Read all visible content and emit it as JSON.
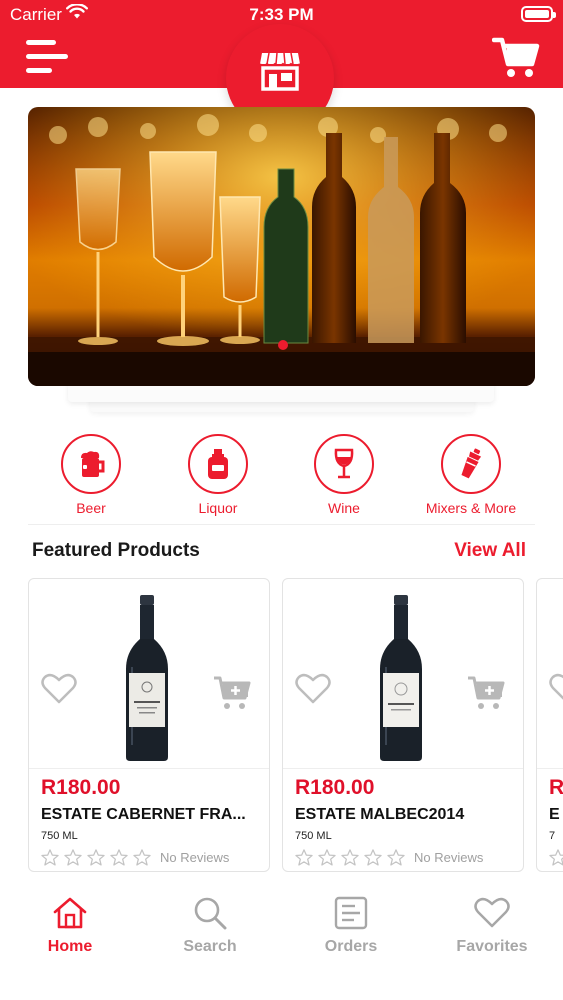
{
  "status_bar": {
    "carrier": "Carrier",
    "time": "7:33 PM"
  },
  "colors": {
    "brand_red": "#ec1c2e",
    "price_red": "#e0102a",
    "inactive_gray": "#a7a7a7"
  },
  "categories": [
    {
      "label": "Beer",
      "icon": "beer-mug-icon"
    },
    {
      "label": "Liquor",
      "icon": "liquor-bottle-icon"
    },
    {
      "label": "Wine",
      "icon": "wine-glass-icon"
    },
    {
      "label": "Mixers & More",
      "icon": "cocktail-shaker-icon"
    }
  ],
  "featured": {
    "title": "Featured Products",
    "view_all": "View All",
    "products": [
      {
        "price": "R180.00",
        "name": "ESTATE CABERNET FRA...",
        "size": "750 ML",
        "reviews": "No Reviews",
        "rating": 0,
        "max_rating": 5
      },
      {
        "price": "R180.00",
        "name": "ESTATE MALBEC2014",
        "size": "750 ML",
        "reviews": "No Reviews",
        "rating": 0,
        "max_rating": 5
      },
      {
        "price": "R",
        "name": "E",
        "size": "7",
        "reviews": "",
        "rating": 0,
        "max_rating": 5
      }
    ]
  },
  "tabs": [
    {
      "label": "Home",
      "icon": "home-icon",
      "active": true
    },
    {
      "label": "Search",
      "icon": "search-icon",
      "active": false
    },
    {
      "label": "Orders",
      "icon": "orders-icon",
      "active": false
    },
    {
      "label": "Favorites",
      "icon": "heart-icon",
      "active": false
    }
  ],
  "banner": {
    "slide_index": 1,
    "slide_count": 1
  }
}
